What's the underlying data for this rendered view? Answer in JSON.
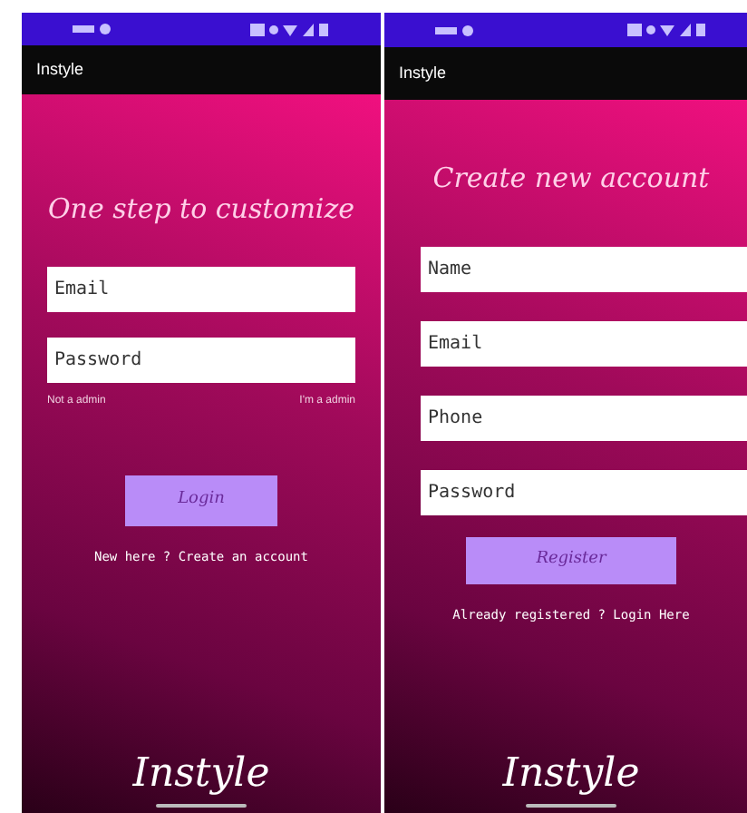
{
  "screens": [
    {
      "app_bar": {
        "title": "Instyle"
      },
      "heading": "One step to customize",
      "fields": [
        {
          "placeholder": "Email"
        },
        {
          "placeholder": "Password"
        }
      ],
      "options": [
        "Not a admin",
        "I'm a admin"
      ],
      "button": "Login",
      "footer_link": "New here ? Create an account",
      "logo": "Instyle"
    },
    {
      "app_bar": {
        "title": "Instyle"
      },
      "heading": "Create new account",
      "fields": [
        {
          "placeholder": "Name"
        },
        {
          "placeholder": "Email"
        },
        {
          "placeholder": "Phone"
        },
        {
          "placeholder": "Password"
        }
      ],
      "button": "Register",
      "footer_link": "Already registered ? Login Here",
      "logo": "Instyle"
    }
  ]
}
